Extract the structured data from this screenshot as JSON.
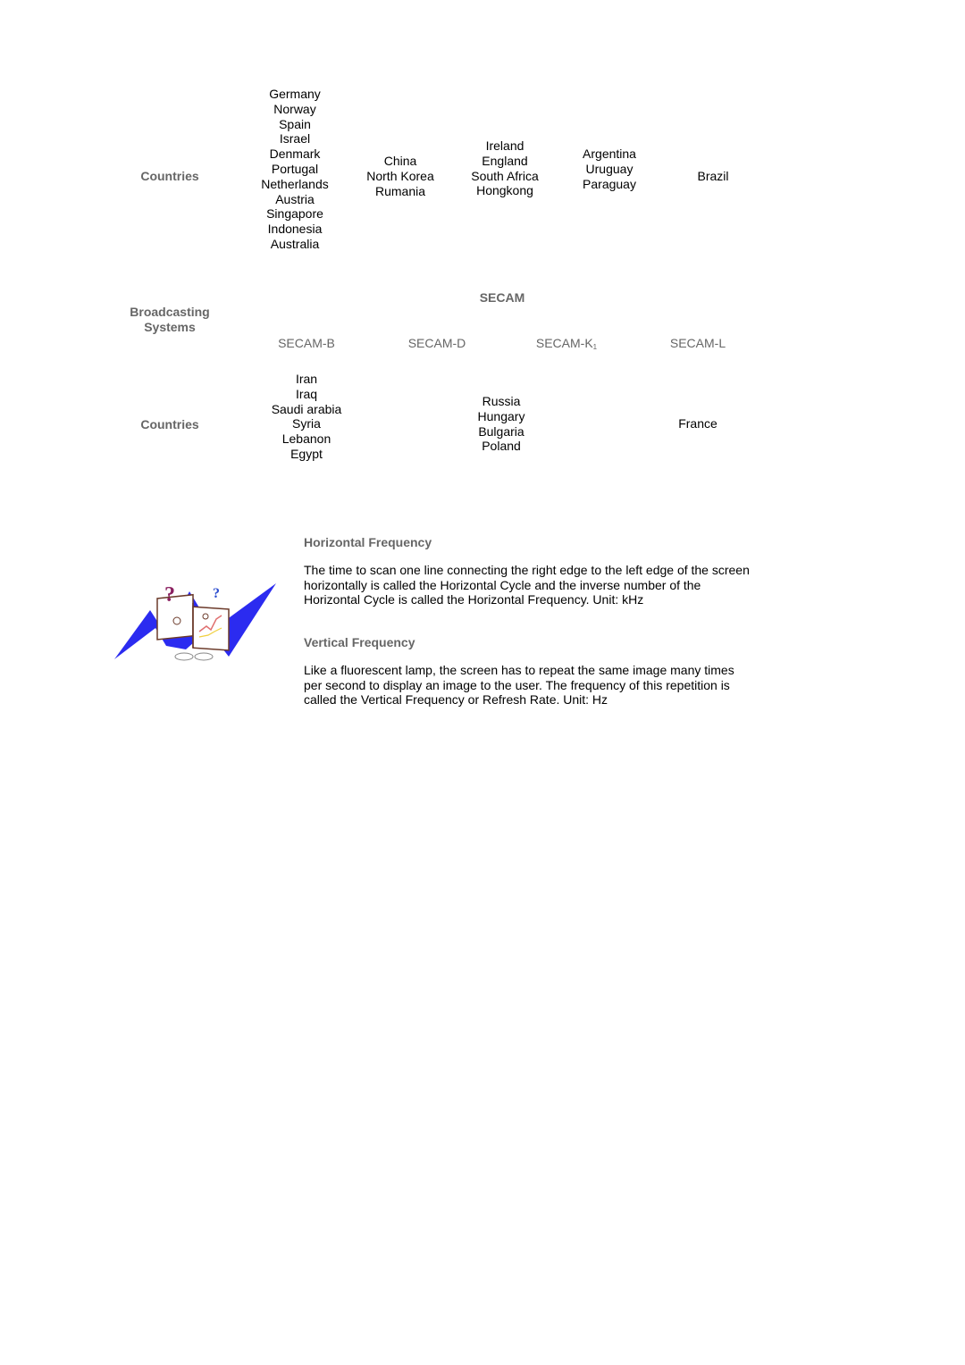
{
  "table1": {
    "row_header": "Countries",
    "columns": [
      {
        "countries": [
          "Germany",
          "Norway",
          "Spain",
          "Israel",
          "Denmark",
          "Portugal",
          "Netherlands",
          "Austria",
          "Singapore",
          "Indonesia",
          "Australia"
        ]
      },
      {
        "countries": [
          "China",
          "North Korea",
          "Rumania"
        ]
      },
      {
        "countries": [
          "Ireland",
          "England",
          "South Africa",
          "Hongkong"
        ]
      },
      {
        "countries": [
          "Argentina",
          "Uruguay",
          "Paraguay"
        ]
      },
      {
        "countries": [
          "Brazil"
        ]
      }
    ]
  },
  "table2": {
    "broadcasting_header_line1": "Broadcasting",
    "broadcasting_header_line2": "Systems",
    "system_group": "SECAM",
    "systems": [
      {
        "label": "SECAM-B",
        "subscript": ""
      },
      {
        "label": "SECAM-D",
        "subscript": ""
      },
      {
        "label": "SECAM-K",
        "subscript": "1"
      },
      {
        "label": "SECAM-L",
        "subscript": ""
      }
    ],
    "row_header": "Countries",
    "countries": [
      [
        "Iran",
        "Iraq",
        "Saudi arabia",
        "Syria",
        "Lebanon",
        "Egypt"
      ],
      [
        "Russia",
        "Hungary",
        "Bulgaria",
        "Poland"
      ],
      [
        "France"
      ]
    ]
  },
  "sections": [
    {
      "title": "Horizontal Frequency",
      "body": "The time to scan one line connecting the right edge to the left edge of the screen horizontally is called the Horizontal Cycle and the inverse number of the Horizontal Cycle is called the Horizontal Frequency. Unit: kHz"
    },
    {
      "title": "Vertical Frequency",
      "body": "Like a fluorescent lamp, the screen has to repeat the same image many times per second to display an image to the user. The frequency of this repetition is called the Vertical Frequency or Refresh Rate. Unit: Hz"
    }
  ],
  "illustration": {
    "icon": "confused-book-icon",
    "accent_color": "#2b2bf0"
  }
}
